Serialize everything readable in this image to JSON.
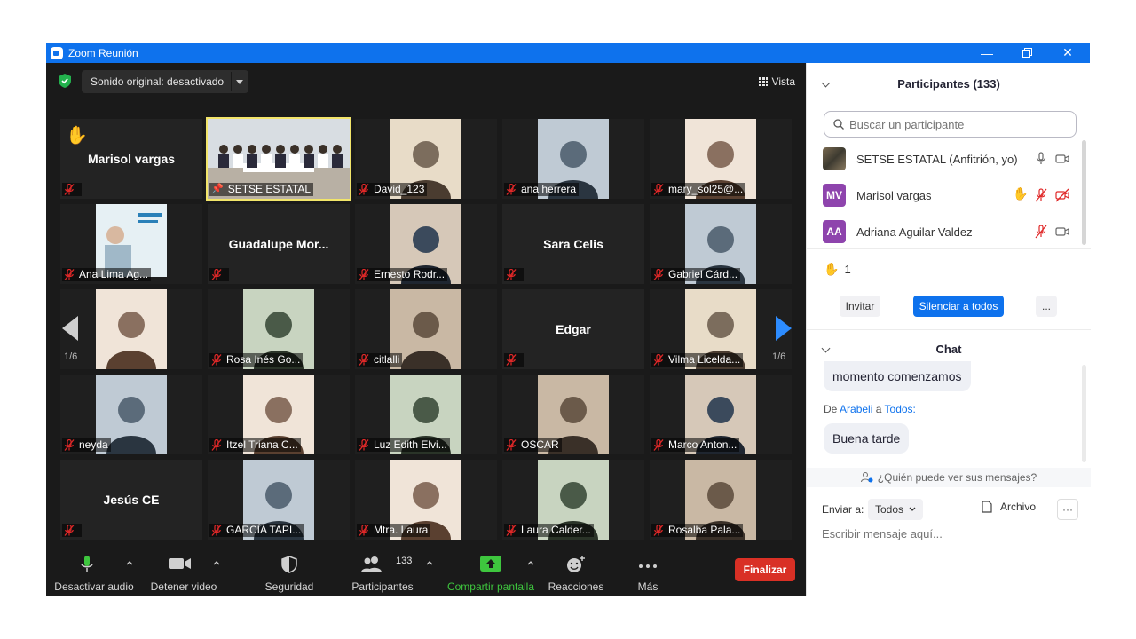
{
  "window": {
    "title": "Zoom Reunión"
  },
  "meeting": {
    "sound_button": "Sonido original: desactivado",
    "view_button": "Vista",
    "page_left": "1/6",
    "page_right": "1/6",
    "tiles": [
      {
        "name": "Marisol vargas",
        "label": "",
        "big": true,
        "hand": true,
        "mute": true
      },
      {
        "name": "",
        "label": "SETSE ESTATAL",
        "pinned": true,
        "photo": "meeting-room"
      },
      {
        "name": "",
        "label": "David_123",
        "mute": true,
        "photo": "person"
      },
      {
        "name": "",
        "label": "ana herrera",
        "mute": true,
        "photo": "person"
      },
      {
        "name": "",
        "label": "mary_sol25@...",
        "mute": true,
        "photo": "person"
      },
      {
        "name": "",
        "label": "Ana Lima Ag...",
        "mute": true,
        "photo": "poster"
      },
      {
        "name": "Guadalupe  Mor...",
        "label": "",
        "big": true,
        "mute": true
      },
      {
        "name": "",
        "label": "Ernesto Rodr...",
        "mute": true,
        "photo": "person"
      },
      {
        "name": "Sara Celis",
        "label": "",
        "big": true,
        "mute": true
      },
      {
        "name": "",
        "label": "Gabriel Cárd...",
        "mute": true,
        "photo": "person"
      },
      {
        "name": "",
        "label": "",
        "mute": false,
        "photo": "person"
      },
      {
        "name": "",
        "label": "Rosa Inés Go...",
        "mute": true,
        "photo": "person"
      },
      {
        "name": "",
        "label": "citlalli",
        "mute": true,
        "photo": "person"
      },
      {
        "name": "Edgar",
        "label": "",
        "big": true,
        "mute": true
      },
      {
        "name": "",
        "label": "Vilma Licelda...",
        "mute": true,
        "photo": "person"
      },
      {
        "name": "",
        "label": "neyda",
        "mute": true,
        "photo": "person"
      },
      {
        "name": "",
        "label": "Itzel Triana C...",
        "mute": true,
        "photo": "person"
      },
      {
        "name": "",
        "label": "Luz Edith Elvi...",
        "mute": true,
        "photo": "person"
      },
      {
        "name": "",
        "label": "OSCAR",
        "mute": true,
        "photo": "person"
      },
      {
        "name": "",
        "label": "Marco Anton...",
        "mute": true,
        "photo": "person"
      },
      {
        "name": "Jesús CE",
        "label": "",
        "big": true,
        "mute": true
      },
      {
        "name": "",
        "label": "GARCÍA TAPI...",
        "mute": true,
        "photo": "person"
      },
      {
        "name": "",
        "label": "Mtra. Laura",
        "mute": true,
        "photo": "person"
      },
      {
        "name": "",
        "label": "Laura Calder...",
        "mute": true,
        "photo": "person"
      },
      {
        "name": "",
        "label": "Rosalba Pala...",
        "mute": true,
        "photo": "person"
      }
    ]
  },
  "toolbar": {
    "audio": "Desactivar audio",
    "video": "Detener video",
    "security": "Seguridad",
    "participants": "Participantes",
    "participants_count": "133",
    "share": "Compartir pantalla",
    "reactions": "Reacciones",
    "more": "Más",
    "end": "Finalizar"
  },
  "panel": {
    "participants_title": "Participantes (133)",
    "search_placeholder": "Buscar un participante",
    "participants": [
      {
        "name": "SETSE ESTATAL (Anfitrión, yo)",
        "initials": "",
        "color": "#5a5040"
      },
      {
        "name": "Marisol vargas",
        "initials": "MV",
        "color": "#8e44ad"
      },
      {
        "name": "Adriana Aguilar Valdez",
        "initials": "AA",
        "color": "#8e44ad"
      }
    ],
    "raised_hands": "1",
    "invite": "Invitar",
    "mute_all": "Silenciar a todos",
    "more": "...",
    "chat_title": "Chat",
    "chat_msg1": "momento comenzamos",
    "sender_prefix": "De",
    "sender": "Arabeli",
    "sender_to": "a",
    "recipient": "Todos:",
    "chat_msg2": "Buena tarde",
    "who_can_see": "¿Quién puede ver sus mensajes?",
    "send_to_label": "Enviar a:",
    "send_to_value": "Todos",
    "file_label": "Archivo",
    "more_dots": "···",
    "message_placeholder": "Escribir mensaje aquí..."
  },
  "colors": {
    "accent": "#0e72ed",
    "end": "#d93025",
    "share": "#3ec63e",
    "mute": "#e02828",
    "pin": "#f2e56a"
  }
}
